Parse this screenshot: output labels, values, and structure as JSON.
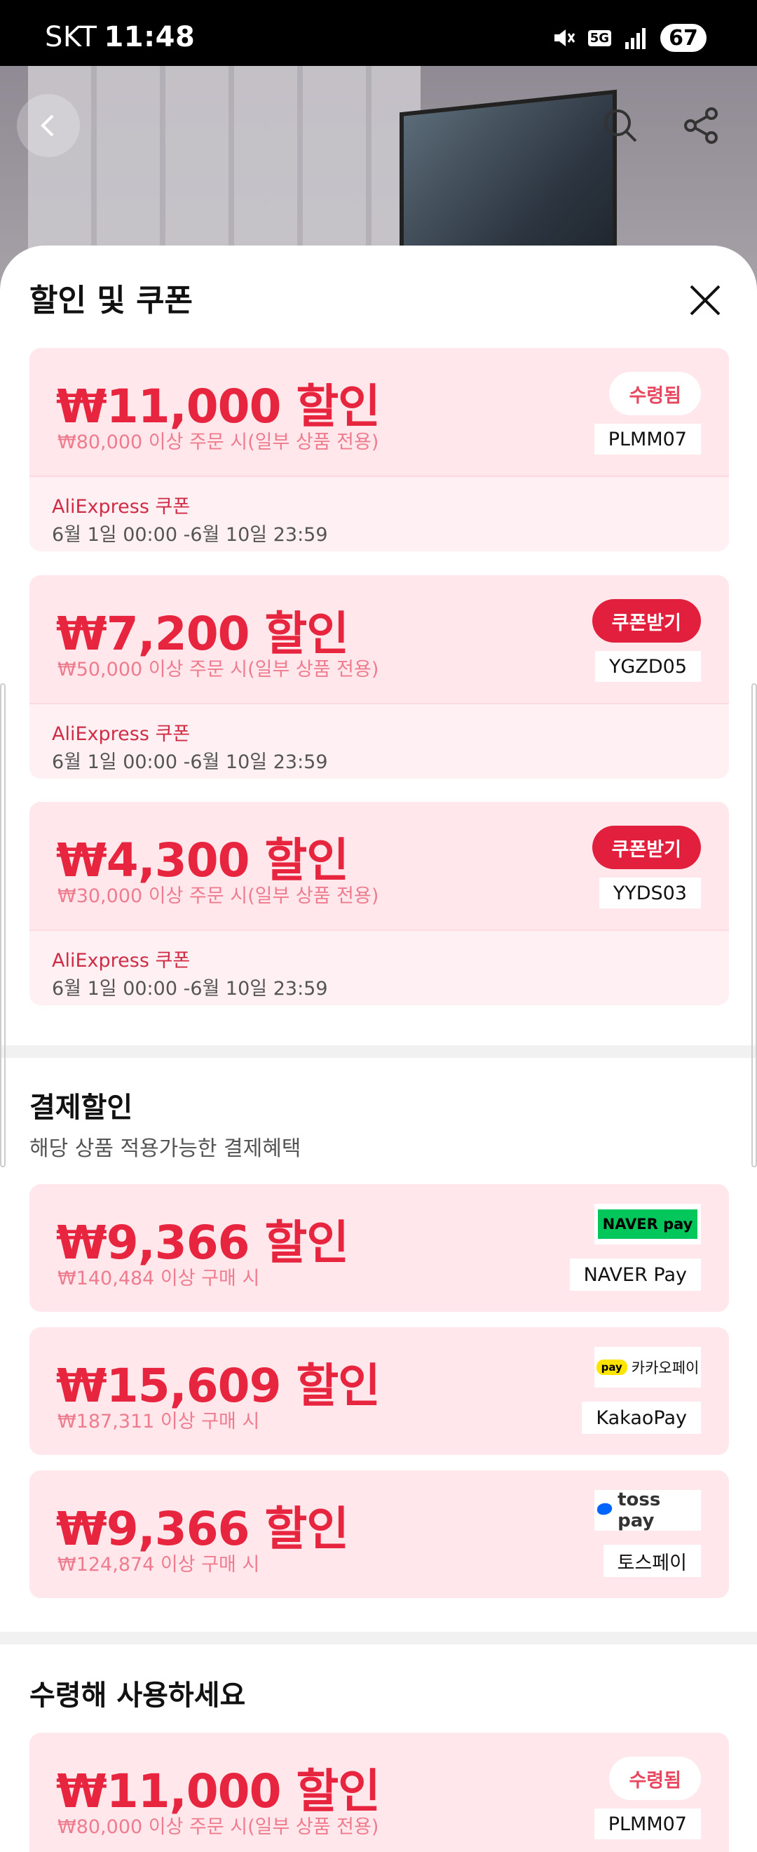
{
  "status_bar": {
    "carrier": "SKT",
    "time": "11:48",
    "network": "5G",
    "battery": "67"
  },
  "sheet": {
    "title": "할인 및 쿠폰"
  },
  "coupons": [
    {
      "amount": "₩11,000 할인",
      "condition": "₩80,000 이상 주문 시(일부 상품 전용)",
      "status": "수령됨",
      "code": "PLMM07",
      "source": "AliExpress 쿠폰",
      "dates": "6월 1일 00:00 -6월 10일 23:59"
    },
    {
      "amount": "₩7,200 할인",
      "condition": "₩50,000 이상 주문 시(일부 상품 전용)",
      "status": "쿠폰받기",
      "code": "YGZD05",
      "source": "AliExpress 쿠폰",
      "dates": "6월 1일 00:00 -6월 10일 23:59"
    },
    {
      "amount": "₩4,300 할인",
      "condition": "₩30,000 이상 주문 시(일부 상품 전용)",
      "status": "쿠폰받기",
      "code": "YYDS03",
      "source": "AliExpress 쿠폰",
      "dates": "6월 1일 00:00 -6월 10일 23:59"
    }
  ],
  "payment_section": {
    "title": "결제할인",
    "subtitle": "해당 상품 적용가능한 결제혜택",
    "items": [
      {
        "amount": "₩9,366 할인",
        "condition": "₩140,484 이상 구매 시",
        "logo_text": "NAVER pay",
        "name": "NAVER Pay"
      },
      {
        "amount": "₩15,609 할인",
        "condition": "₩187,311 이상 구매 시",
        "logo_text": "카카오페이",
        "logo_badge": "pay",
        "name": "KakaoPay"
      },
      {
        "amount": "₩9,366 할인",
        "condition": "₩124,874 이상 구매 시",
        "logo_text": "toss pay",
        "name": "토스페이"
      }
    ]
  },
  "receive_section": {
    "title": "수령해 사용하세요",
    "coupon": {
      "amount": "₩11,000 할인",
      "condition": "₩80,000 이상 주문 시(일부 상품 전용)",
      "status": "수령됨",
      "code": "PLMM07"
    }
  },
  "colors": {
    "accent": "#e2203e",
    "card_bg": "#ffe7ec",
    "naver_green": "#03c75a",
    "kakao_yellow": "#fee500",
    "toss_blue": "#0064ff"
  }
}
